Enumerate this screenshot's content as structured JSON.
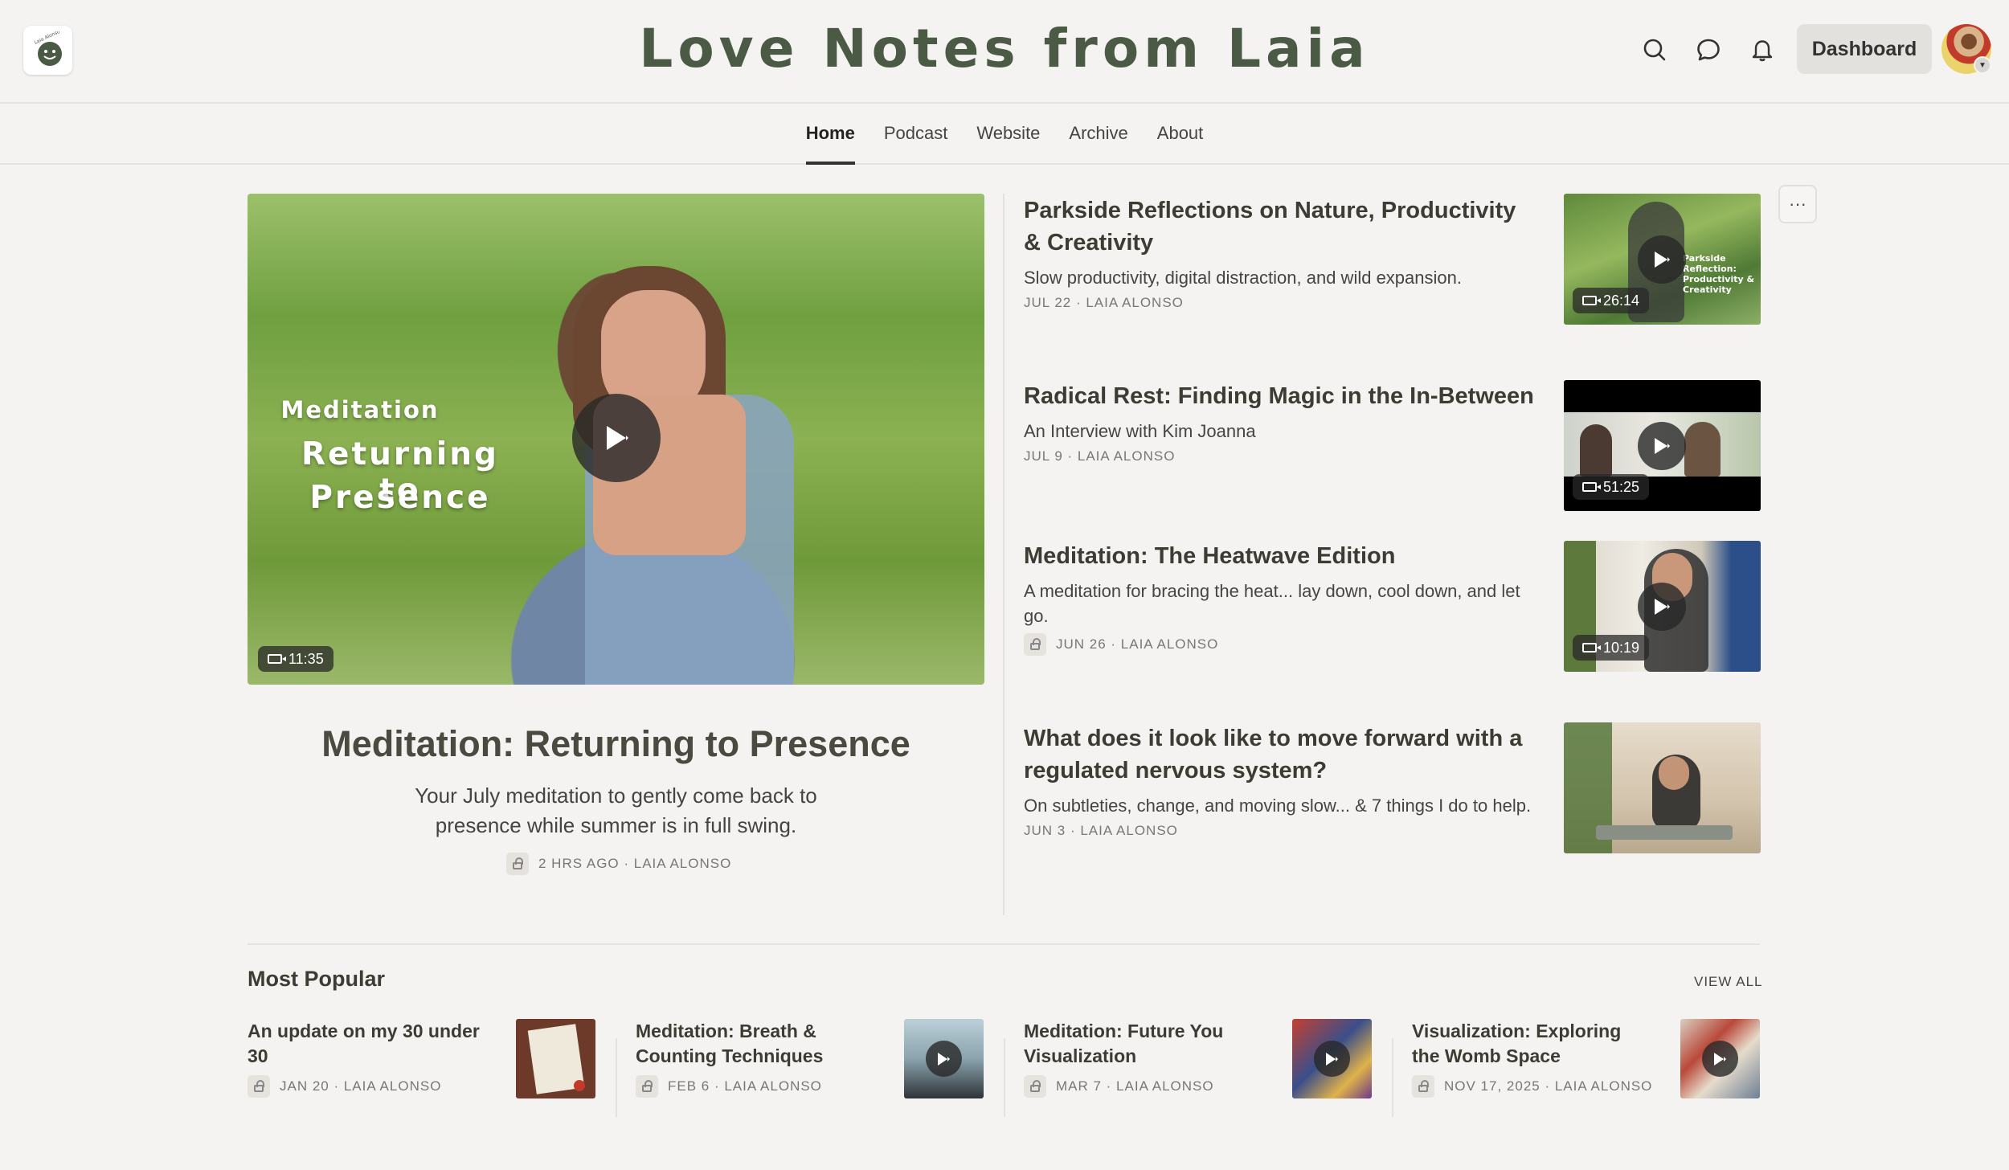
{
  "header": {
    "site_title": "Love Notes from Laia",
    "logo_text": "Laia Alonso",
    "dashboard_label": "Dashboard",
    "icons": [
      "search-icon",
      "chat-icon",
      "bell-icon"
    ]
  },
  "nav": {
    "items": [
      {
        "label": "Home",
        "active": true
      },
      {
        "label": "Podcast"
      },
      {
        "label": "Website"
      },
      {
        "label": "Archive"
      },
      {
        "label": "About"
      }
    ]
  },
  "hero": {
    "overlay_line1": "Meditation",
    "overlay_line2": "Returning to",
    "overlay_line3": "Presence",
    "duration": "11:35",
    "title": "Meditation: Returning to Presence",
    "subtitle": "Your July meditation to gently come back to presence while summer is in full swing.",
    "meta": "2 HRS AGO · LAIA ALONSO",
    "locked": true
  },
  "posts": [
    {
      "title": "Parkside Reflections on Nature, Productivity & Creativity",
      "subtitle": "Slow productivity, digital distraction, and wild expansion.",
      "meta": "JUL 22 · LAIA ALONSO",
      "duration": "26:14",
      "thumb_text": "Parkside Reflection: Productivity & Creativity"
    },
    {
      "title": "Radical Rest: Finding Magic in the In-Between",
      "subtitle": "An Interview with Kim Joanna",
      "meta": "JUL 9 · LAIA ALONSO",
      "duration": "51:25"
    },
    {
      "title": "Meditation: The Heatwave Edition",
      "subtitle": "A meditation for bracing the heat... lay down, cool down, and let go.",
      "meta": "JUN 26 · LAIA ALONSO",
      "duration": "10:19",
      "locked": true
    },
    {
      "title": "What does it look like to move forward with a regulated nervous system?",
      "subtitle": "On subtleties, change, and moving slow... & 7 things I do to help.",
      "meta": "JUN 3 · LAIA ALONSO"
    }
  ],
  "more_label": "···",
  "popular": {
    "heading": "Most Popular",
    "view_all": "VIEW ALL",
    "items": [
      {
        "title": "An update on my 30 under 30",
        "meta": "JAN 20 · LAIA ALONSO",
        "locked": true,
        "video": false
      },
      {
        "title": "Meditation: Breath & Counting Techniques",
        "meta": "FEB 6 · LAIA ALONSO",
        "locked": true,
        "video": true
      },
      {
        "title": "Meditation: Future You Visualization",
        "meta": "MAR 7 · LAIA ALONSO",
        "locked": true,
        "video": true
      },
      {
        "title": "Visualization: Exploring the Womb Space",
        "meta": "NOV 17, 2025 · LAIA ALONSO",
        "locked": true,
        "video": true
      }
    ]
  },
  "colors": {
    "background": "#f5f3f1",
    "title_green": "#4b5a45",
    "text": "#36392e"
  }
}
